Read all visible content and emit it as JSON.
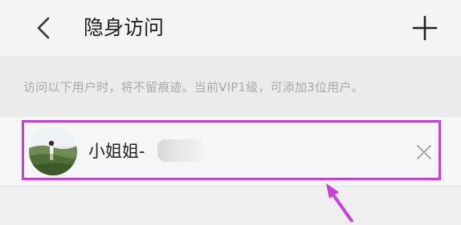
{
  "header": {
    "title": "隐身访问",
    "back_icon": "chevron-left-icon",
    "add_icon": "plus-icon"
  },
  "info": {
    "text": "访问以下用户时，将不留痕迹。当前VIP1级，可添加3位用户。"
  },
  "users": [
    {
      "name": "小姐姐-",
      "name_obscured": true,
      "avatar_icon": "user-avatar",
      "remove_icon": "close-icon"
    }
  ],
  "annotation": {
    "highlight_color": "#c341d6",
    "arrow_color": "#c341d6"
  }
}
